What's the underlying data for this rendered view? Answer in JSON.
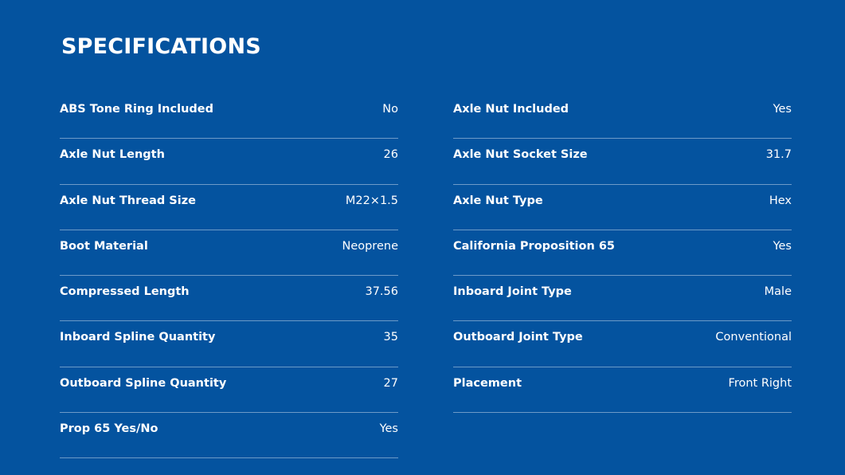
{
  "title": "SPECIFICATIONS",
  "left_specs": [
    {
      "label": "ABS Tone Ring Included",
      "value": "No"
    },
    {
      "label": "Axle Nut Length",
      "value": "26"
    },
    {
      "label": "Axle Nut Thread Size",
      "value": "M22×1.5"
    },
    {
      "label": "Boot Material",
      "value": "Neoprene"
    },
    {
      "label": "Compressed Length",
      "value": "37.56"
    },
    {
      "label": "Inboard Spline Quantity",
      "value": "35"
    },
    {
      "label": "Outboard Spline Quantity",
      "value": "27"
    },
    {
      "label": "Prop 65 Yes/No",
      "value": "Yes"
    }
  ],
  "right_specs": [
    {
      "label": "Axle Nut Included",
      "value": "Yes"
    },
    {
      "label": "Axle Nut Socket Size",
      "value": "31.7"
    },
    {
      "label": "Axle Nut Type",
      "value": "Hex"
    },
    {
      "label": "California Proposition 65",
      "value": "Yes"
    },
    {
      "label": "Inboard Joint Type",
      "value": "Male"
    },
    {
      "label": "Outboard Joint Type",
      "value": "Conventional"
    },
    {
      "label": "Placement",
      "value": "Front Right"
    }
  ],
  "colors": {
    "background": "#04539f",
    "text": "#ffffff",
    "divider": "#6d9ac8"
  }
}
